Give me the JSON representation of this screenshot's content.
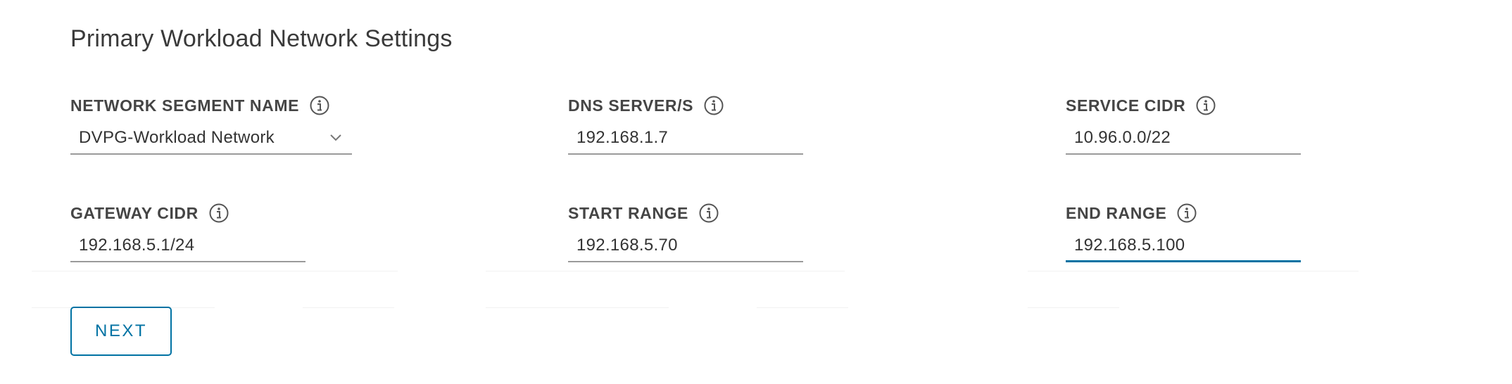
{
  "section": {
    "title": "Primary Workload Network Settings"
  },
  "fields": {
    "network_segment": {
      "label": "NETWORK SEGMENT NAME",
      "value": "DVPG-Workload Network"
    },
    "dns_servers": {
      "label": "DNS SERVER/S",
      "value": "192.168.1.7"
    },
    "service_cidr": {
      "label": "SERVICE CIDR",
      "value": "10.96.0.0/22"
    },
    "gateway_cidr": {
      "label": "GATEWAY CIDR",
      "value": "192.168.5.1/24"
    },
    "start_range": {
      "label": "START RANGE",
      "value": "192.168.5.70"
    },
    "end_range": {
      "label": "END RANGE",
      "value": "192.168.5.100"
    }
  },
  "actions": {
    "next_label": "NEXT"
  },
  "colors": {
    "accent": "#0072a3",
    "input_underline": "#9a9a9a",
    "label_text": "#454545"
  },
  "icons": {
    "info": "info-circle-icon",
    "dropdown": "chevron-down-icon"
  }
}
